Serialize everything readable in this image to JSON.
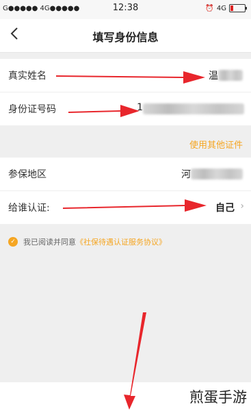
{
  "status_bar": {
    "carrier": "G●●●●● 4G●●●●●",
    "time": "12:38",
    "network": "4G"
  },
  "nav": {
    "title": "填写身份信息"
  },
  "form": {
    "name_label": "真实姓名",
    "name_value": "温",
    "id_label": "身份证号码",
    "id_value": "1",
    "use_other_id": "使用其他证件",
    "region_label": "参保地区",
    "region_value": "河",
    "certify_for_label": "给谁认证:",
    "certify_for_value": "自己",
    "chevron": "›"
  },
  "agreement": {
    "prefix": "我已阅读并同意",
    "link": "《社保待遇认证服务协议》",
    "checked": true
  },
  "watermark": "煎蛋手游",
  "colors": {
    "accent": "#f5a623",
    "arrow": "#e8262c"
  },
  "icons": [
    "back-icon",
    "alarm-icon",
    "battery-icon",
    "check-icon",
    "chevron-right-icon"
  ]
}
